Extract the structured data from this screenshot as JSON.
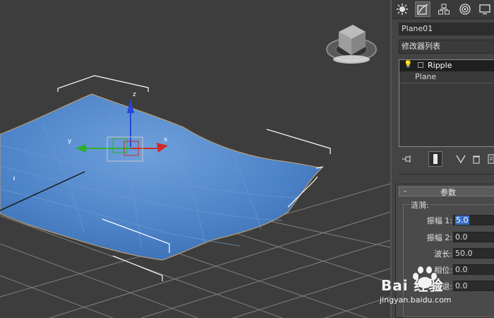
{
  "command_panel": {
    "tabs": [
      {
        "name": "create",
        "icon": "sun-icon"
      },
      {
        "name": "modify",
        "icon": "modify-icon"
      },
      {
        "name": "hierarchy",
        "icon": "hierarchy-icon"
      },
      {
        "name": "motion",
        "icon": "motion-icon"
      },
      {
        "name": "display",
        "icon": "display-icon"
      }
    ],
    "active_tab": "modify",
    "object_name": "Plane01",
    "modifier_list_label": "修改器列表",
    "modifier_stack": [
      {
        "label": "Ripple",
        "selected": true
      },
      {
        "label": "Plane",
        "selected": false
      }
    ]
  },
  "params_rollout": {
    "collapse_symbol": "-",
    "title": "参数",
    "group_label": "涟漪:",
    "params": [
      {
        "label": "振幅 1:",
        "value": "5.0"
      },
      {
        "label": "振幅 2:",
        "value": "0.0"
      },
      {
        "label": "波长:",
        "value": "50.0"
      },
      {
        "label": "相位:",
        "value": "0.0"
      },
      {
        "label": "衰退:",
        "value": "0.0"
      }
    ]
  },
  "viewport": {
    "gizmo_labels": {
      "x": "x",
      "y": "y",
      "z": "z"
    },
    "surface_color": "#4e86cc"
  },
  "watermark": {
    "line1": "Bai 经验",
    "line2": "jingyan.baidu.com"
  }
}
